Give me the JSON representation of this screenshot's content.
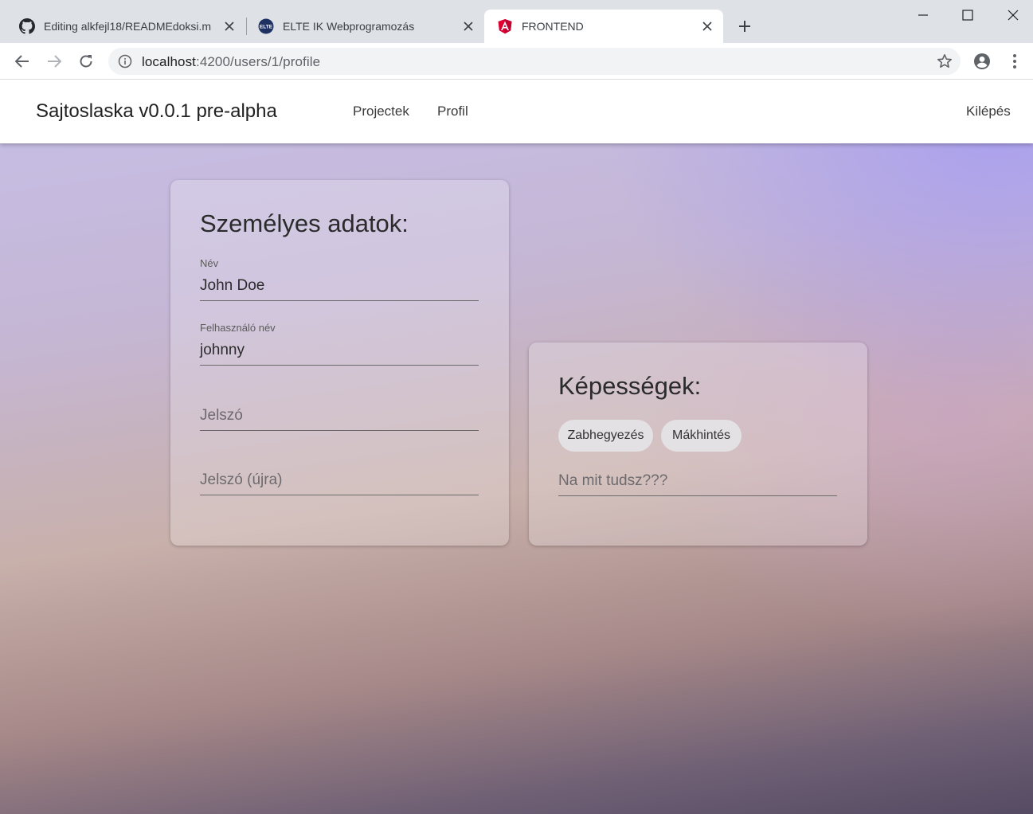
{
  "browser": {
    "tabs": [
      {
        "title": "Editing alkfejl18/READMEdoksi.m",
        "icon": "github-icon",
        "active": false
      },
      {
        "title": "ELTE IK Webprogramozás",
        "icon": "elte-icon",
        "active": false
      },
      {
        "title": "FRONTEND",
        "icon": "angular-icon",
        "active": true
      }
    ],
    "url_host": "localhost",
    "url_path": ":4200/users/1/profile",
    "elte_badge": "ELTE"
  },
  "app": {
    "brand": "Sajtoslaska v0.0.1 pre-alpha",
    "nav": [
      "Projectek",
      "Profil"
    ],
    "logout": "Kilépés"
  },
  "personal": {
    "title": "Személyes adatok:",
    "name_label": "Név",
    "name_value": "John Doe",
    "username_label": "Felhasználó név",
    "username_value": "johnny",
    "password_placeholder": "Jelszó",
    "password_again_placeholder": "Jelszó (újra)"
  },
  "skills": {
    "title": "Képességek:",
    "chips": [
      "Zabhegyezés",
      "Mákhintés"
    ],
    "input_placeholder": "Na mit tudsz???"
  },
  "colors": {
    "accent_gradient_top": "#c6bfe8",
    "accent_gradient_bottom": "#554b63",
    "angular_red": "#dd0031",
    "elte_blue": "#1f3063"
  }
}
